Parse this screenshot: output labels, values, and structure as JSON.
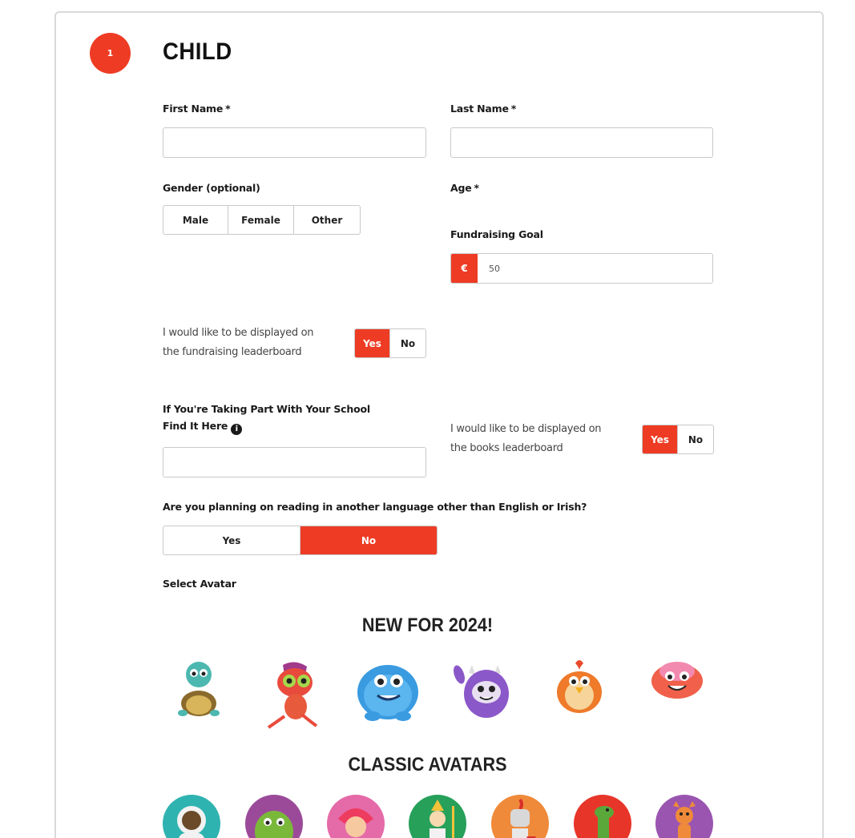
{
  "step": {
    "number": "1",
    "title": "CHILD"
  },
  "fields": {
    "first_name": {
      "label": "First Name",
      "required_mark": "*",
      "value": ""
    },
    "last_name": {
      "label": "Last Name",
      "required_mark": "*",
      "value": ""
    },
    "gender": {
      "label": "Gender (optional)",
      "options": [
        "Male",
        "Female",
        "Other"
      ]
    },
    "age": {
      "label": "Age",
      "required_mark": "*"
    },
    "fundraising_goal": {
      "label": "Fundraising Goal",
      "currency_symbol": "€",
      "value": "50"
    },
    "leaderboard_fundraising": {
      "text_line1": "I would like to be displayed on",
      "text_line2": "the fundraising leaderboard",
      "yes": "Yes",
      "no": "No",
      "selected": "Yes"
    },
    "school": {
      "label_line1": "If You're Taking Part With Your School",
      "label_line2": "Find It Here",
      "info_icon": "i",
      "value": ""
    },
    "leaderboard_books": {
      "text_line1": "I would like to be displayed on",
      "text_line2": "the books leaderboard",
      "yes": "Yes",
      "no": "No",
      "selected": "Yes"
    },
    "other_language": {
      "label": "Are you planning on reading in another language other than English or Irish?",
      "yes": "Yes",
      "no": "No",
      "selected": "No"
    }
  },
  "avatars": {
    "select_label": "Select Avatar",
    "new_heading": "NEW FOR 2024!",
    "new_items": [
      {
        "name": "turtle-avatar",
        "color": "#4cb8b0"
      },
      {
        "name": "chameleon-avatar",
        "color": "#e84a3c"
      },
      {
        "name": "blue-monster-avatar",
        "color": "#3a9be0"
      },
      {
        "name": "purple-yeti-avatar",
        "color": "#8b58c9"
      },
      {
        "name": "chick-avatar",
        "color": "#ee7a2a"
      },
      {
        "name": "pink-monster-avatar",
        "color": "#f0604a"
      }
    ],
    "classic_heading": "CLASSIC AVATARS",
    "classic_items": [
      {
        "name": "astronaut-avatar",
        "color": "#2fb3b0"
      },
      {
        "name": "green-monster-avatar",
        "color": "#9b4a9a"
      },
      {
        "name": "girl-avatar",
        "color": "#e56aa8"
      },
      {
        "name": "knight-green-avatar",
        "color": "#27a05a"
      },
      {
        "name": "knight-orange-avatar",
        "color": "#ef8a3a"
      },
      {
        "name": "dinosaur-avatar",
        "color": "#e8352a"
      },
      {
        "name": "dragon-avatar",
        "color": "#9a55b0"
      }
    ]
  },
  "colors": {
    "accent": "#ee3b24",
    "border": "#c9c9c9"
  }
}
